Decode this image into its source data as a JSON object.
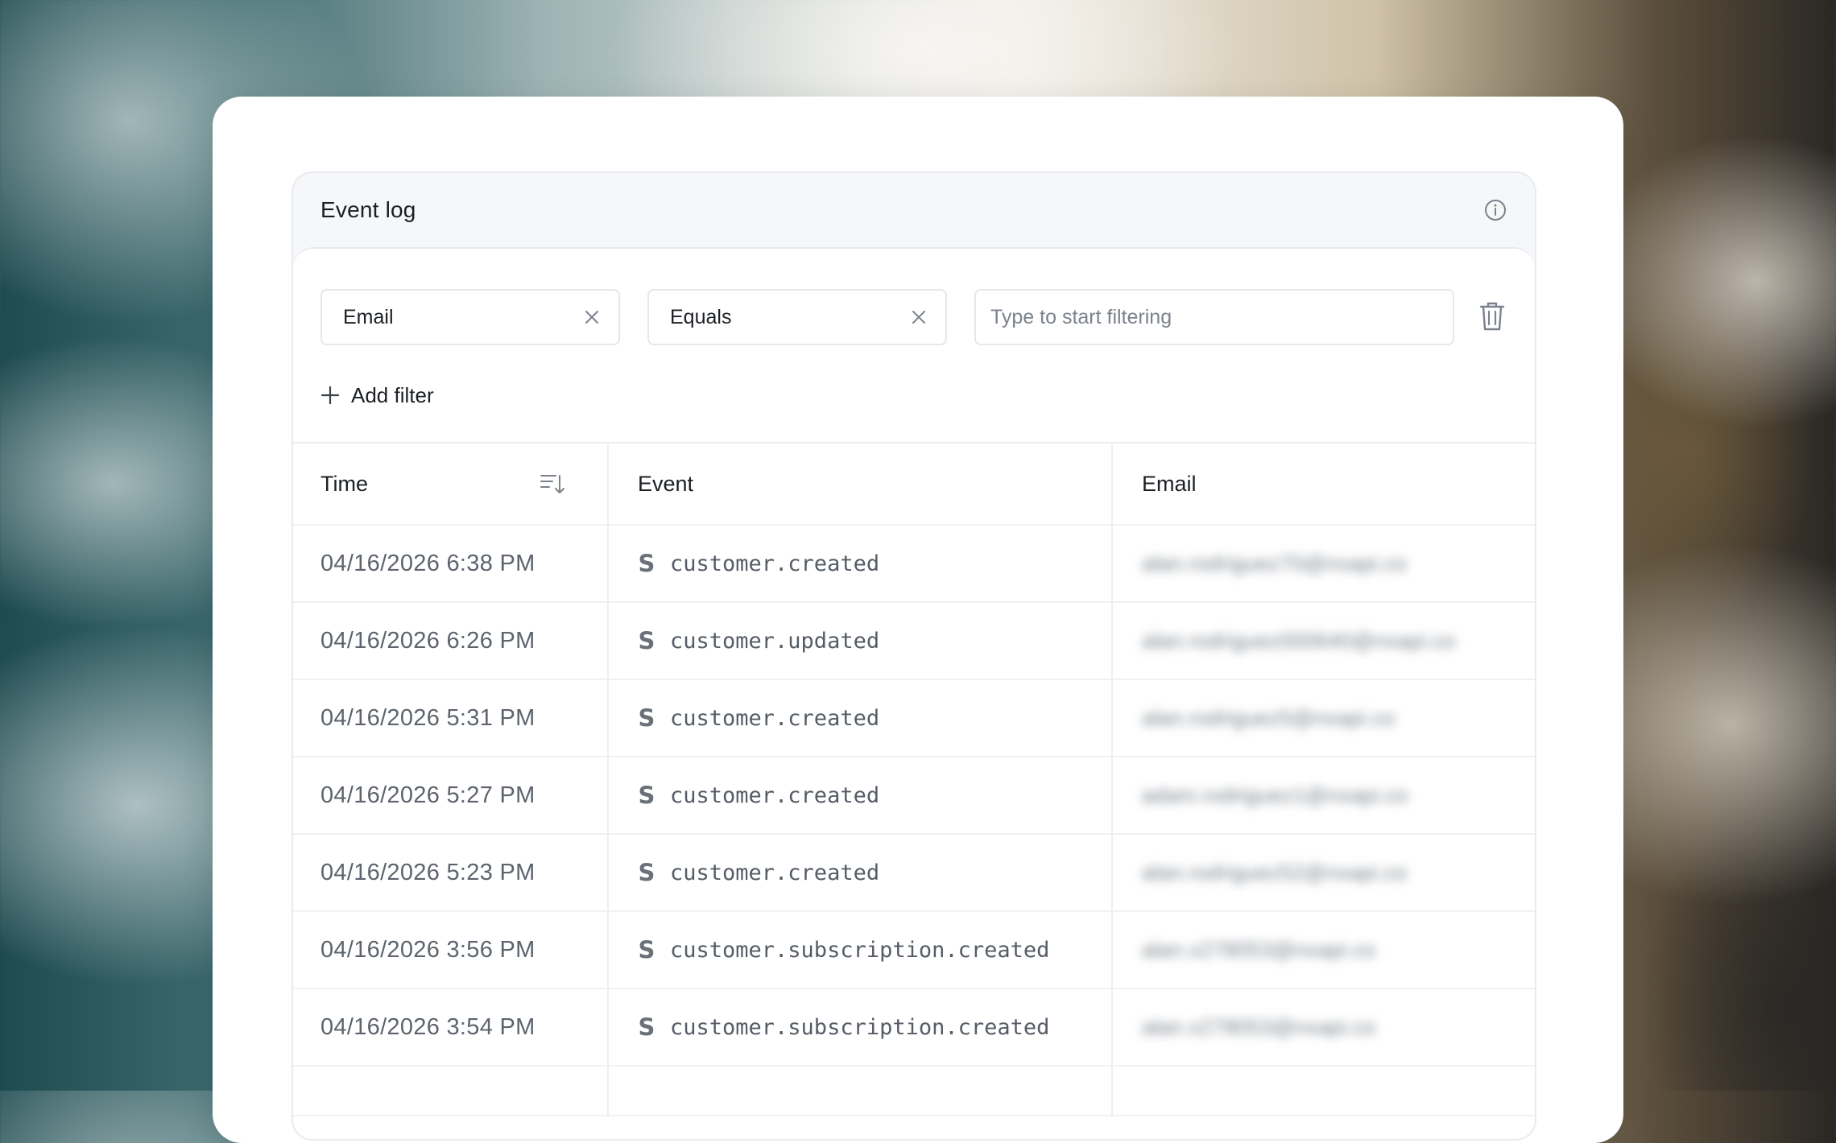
{
  "panel": {
    "title": "Event log"
  },
  "filters": {
    "field_value": "Email",
    "operator_value": "Equals",
    "input_value": "",
    "input_placeholder": "Type to start filtering",
    "add_filter_label": "Add filter"
  },
  "table": {
    "columns": {
      "time": "Time",
      "event": "Event",
      "email": "Email"
    },
    "rows": [
      {
        "time": "04/16/2026 6:38 PM",
        "event_icon": "S",
        "event": "customer.created",
        "email": "alan.rodriguez70@nxapi.co"
      },
      {
        "time": "04/16/2026 6:26 PM",
        "event_icon": "S",
        "event": "customer.updated",
        "email": "alan.rodriguez000640@nxapi.co"
      },
      {
        "time": "04/16/2026 5:31 PM",
        "event_icon": "S",
        "event": "customer.created",
        "email": "alan.rodriguez5@nxapi.co"
      },
      {
        "time": "04/16/2026 5:27 PM",
        "event_icon": "S",
        "event": "customer.created",
        "email": "adam.rodriguez1@nxapi.co"
      },
      {
        "time": "04/16/2026 5:23 PM",
        "event_icon": "S",
        "event": "customer.created",
        "email": "alan.rodriguez52@nxapi.co"
      },
      {
        "time": "04/16/2026 3:56 PM",
        "event_icon": "S",
        "event": "customer.subscription.created",
        "email": "alan.x278053@nxapi.co"
      },
      {
        "time": "04/16/2026 3:54 PM",
        "event_icon": "S",
        "event": "customer.subscription.created",
        "email": "alan.x278053@nxapi.co"
      }
    ]
  },
  "colors": {
    "text_primary": "#1b1f24",
    "text_secondary": "#5d646d",
    "border": "#e7eaee",
    "panel_header_bg": "#f6f7f9"
  },
  "icons": {
    "info": "info-circle-icon",
    "clear": "close-icon",
    "delete": "trash-icon",
    "add": "plus-icon",
    "sort": "sort-descending-icon",
    "event_source": "stripe-s-icon"
  }
}
